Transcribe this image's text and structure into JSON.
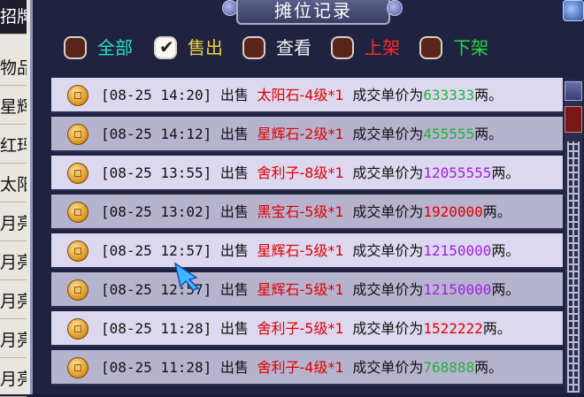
{
  "window": {
    "title": "摊位记录"
  },
  "background_list": [
    {
      "label": "招牌"
    },
    {
      "label": "物品"
    },
    {
      "label": "星辉"
    },
    {
      "label": "红玛"
    },
    {
      "label": "太阳"
    },
    {
      "label": "月亮"
    },
    {
      "label": "月亮"
    },
    {
      "label": "月亮"
    },
    {
      "label": "月亮"
    },
    {
      "label": "月亮"
    }
  ],
  "filters": [
    {
      "label": "全部",
      "checked": false,
      "color": "#28e0c8"
    },
    {
      "label": "售出",
      "checked": true,
      "color": "#f0d13a"
    },
    {
      "label": "查看",
      "checked": false,
      "color": "#f4f4f4"
    },
    {
      "label": "上架",
      "checked": false,
      "color": "#ff2a2a"
    },
    {
      "label": "下架",
      "checked": false,
      "color": "#23d93f"
    }
  ],
  "records": [
    {
      "time": "[08-25 14:20]",
      "action": "出售",
      "item": "太阳石-4级*1",
      "price_label": "成交单价为",
      "price": "633333",
      "price_color": "#22b23a",
      "unit": "两。"
    },
    {
      "time": "[08-25 14:12]",
      "action": "出售",
      "item": "星辉石-2级*1",
      "price_label": "成交单价为",
      "price": "455555",
      "price_color": "#22b23a",
      "unit": "两。"
    },
    {
      "time": "[08-25 13:55]",
      "action": "出售",
      "item": "舍利子-8级*1",
      "price_label": "成交单价为",
      "price": "12055555",
      "price_color": "#a020e0",
      "unit": "两。"
    },
    {
      "time": "[08-25 13:02]",
      "action": "出售",
      "item": "黑宝石-5级*1",
      "price_label": "成交单价为",
      "price": "1920000",
      "price_color": "#e00000",
      "unit": "两。"
    },
    {
      "time": "[08-25 12:57]",
      "action": "出售",
      "item": "星辉石-5级*1",
      "price_label": "成交单价为",
      "price": "12150000",
      "price_color": "#a020e0",
      "unit": "两。"
    },
    {
      "time": "[08-25 12:57]",
      "action": "出售",
      "item": "星辉石-5级*1",
      "price_label": "成交单价为",
      "price": "12150000",
      "price_color": "#a020e0",
      "unit": "两。"
    },
    {
      "time": "[08-25 11:28]",
      "action": "出售",
      "item": "舍利子-5级*1",
      "price_label": "成交单价为",
      "price": "1522222",
      "price_color": "#e00000",
      "unit": "两。"
    },
    {
      "time": "[08-25 11:28]",
      "action": "出售",
      "item": "舍利子-4级*1",
      "price_label": "成交单价为",
      "price": "768888",
      "price_color": "#22b23a",
      "unit": "两。"
    }
  ]
}
